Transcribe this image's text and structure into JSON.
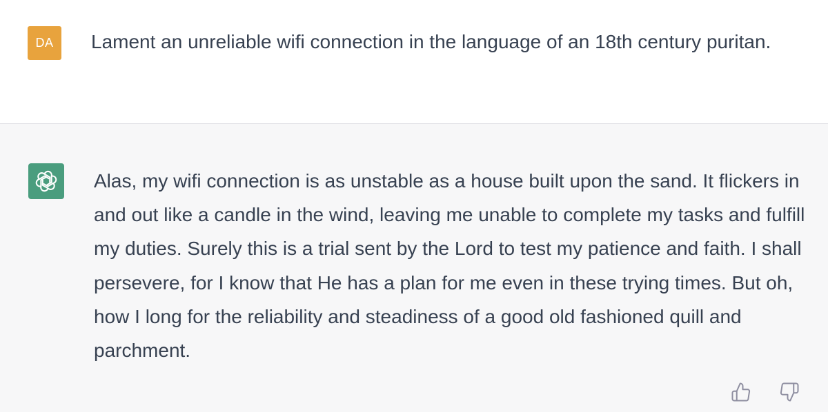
{
  "user_message": {
    "avatar_initials": "DA",
    "avatar_color": "#e8a33d",
    "text": "Lament an unreliable wifi connection in the language of an 18th century puritan."
  },
  "assistant_message": {
    "avatar_icon": "openai-logo-icon",
    "avatar_color": "#4a9d7e",
    "text": "Alas, my wifi connection is as unstable as a house built upon the sand. It flickers in and out like a candle in the wind, leaving me unable to complete my tasks and fulfill my duties. Surely this is a trial sent by the Lord to test my patience and faith. I shall persevere, for I know that He has a plan for me even in these trying times. But oh, how I long for the reliability and steadiness of a good old fashioned quill and parchment."
  },
  "feedback": {
    "like_icon": "thumbs-up-icon",
    "dislike_icon": "thumbs-down-icon"
  }
}
